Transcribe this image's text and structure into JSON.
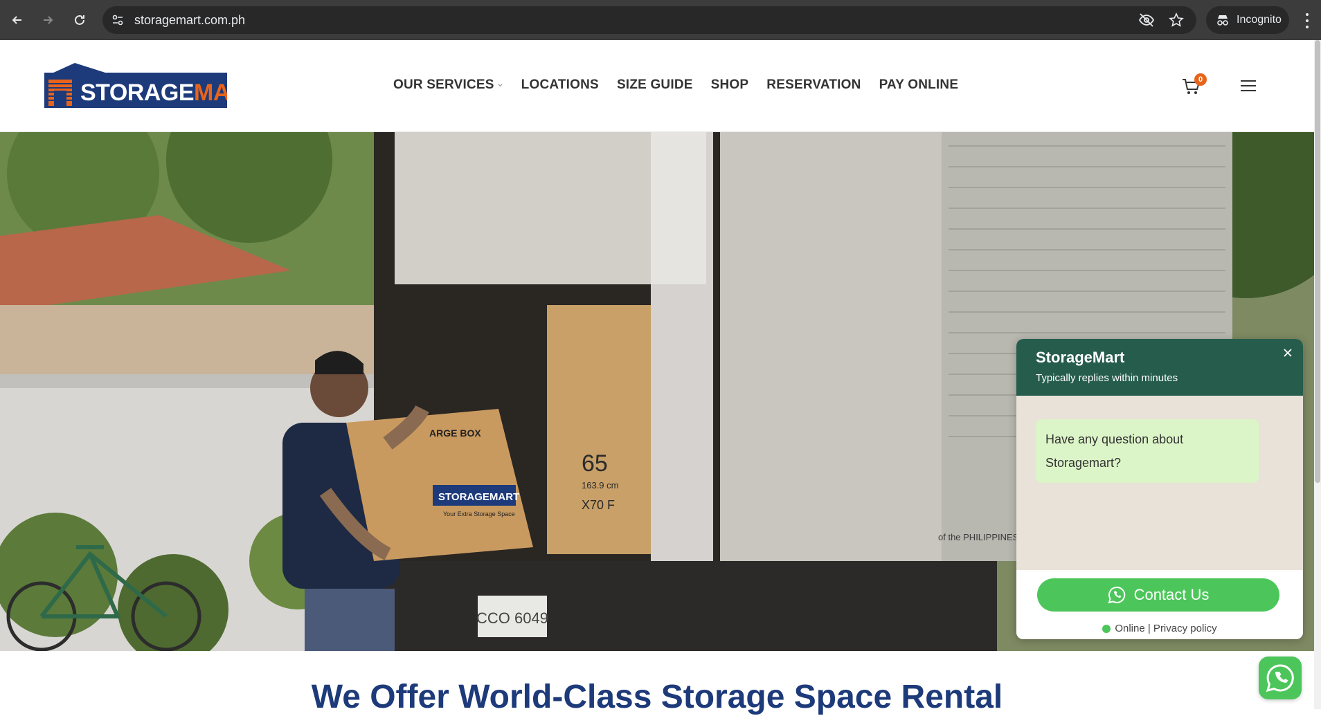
{
  "browser": {
    "url": "storagemart.com.ph",
    "profile_label": "Incognito"
  },
  "header": {
    "logo_text": "STORAGEMART",
    "nav": [
      {
        "label": "OUR SERVICES",
        "has_dropdown": true
      },
      {
        "label": "LOCATIONS"
      },
      {
        "label": "SIZE GUIDE"
      },
      {
        "label": "SHOP"
      },
      {
        "label": "RESERVATION"
      },
      {
        "label": "PAY ONLINE"
      }
    ],
    "cart_count": "0"
  },
  "hero": {
    "box_brand": "STORAGEMART",
    "box_tagline": "Your Extra Storage Space",
    "box_label": "ARGE BOX",
    "tv_size": "65",
    "tv_cm": "163.9 cm",
    "tv_model": "X70 F",
    "plate": "CCO 6049",
    "truck_text": "of the PHILIPPINES"
  },
  "content": {
    "heading": "We Offer World-Class Storage Space Rental"
  },
  "chat": {
    "title": "StorageMart",
    "subtitle": "Typically replies within minutes",
    "message": "Have any question about Storagemart?",
    "button_label": "Contact Us",
    "status": "Online | Privacy policy"
  },
  "colors": {
    "brand_blue": "#1d3a7a",
    "brand_orange": "#e8641b",
    "chat_header": "#265c4c",
    "whatsapp_green": "#4cc65a"
  }
}
